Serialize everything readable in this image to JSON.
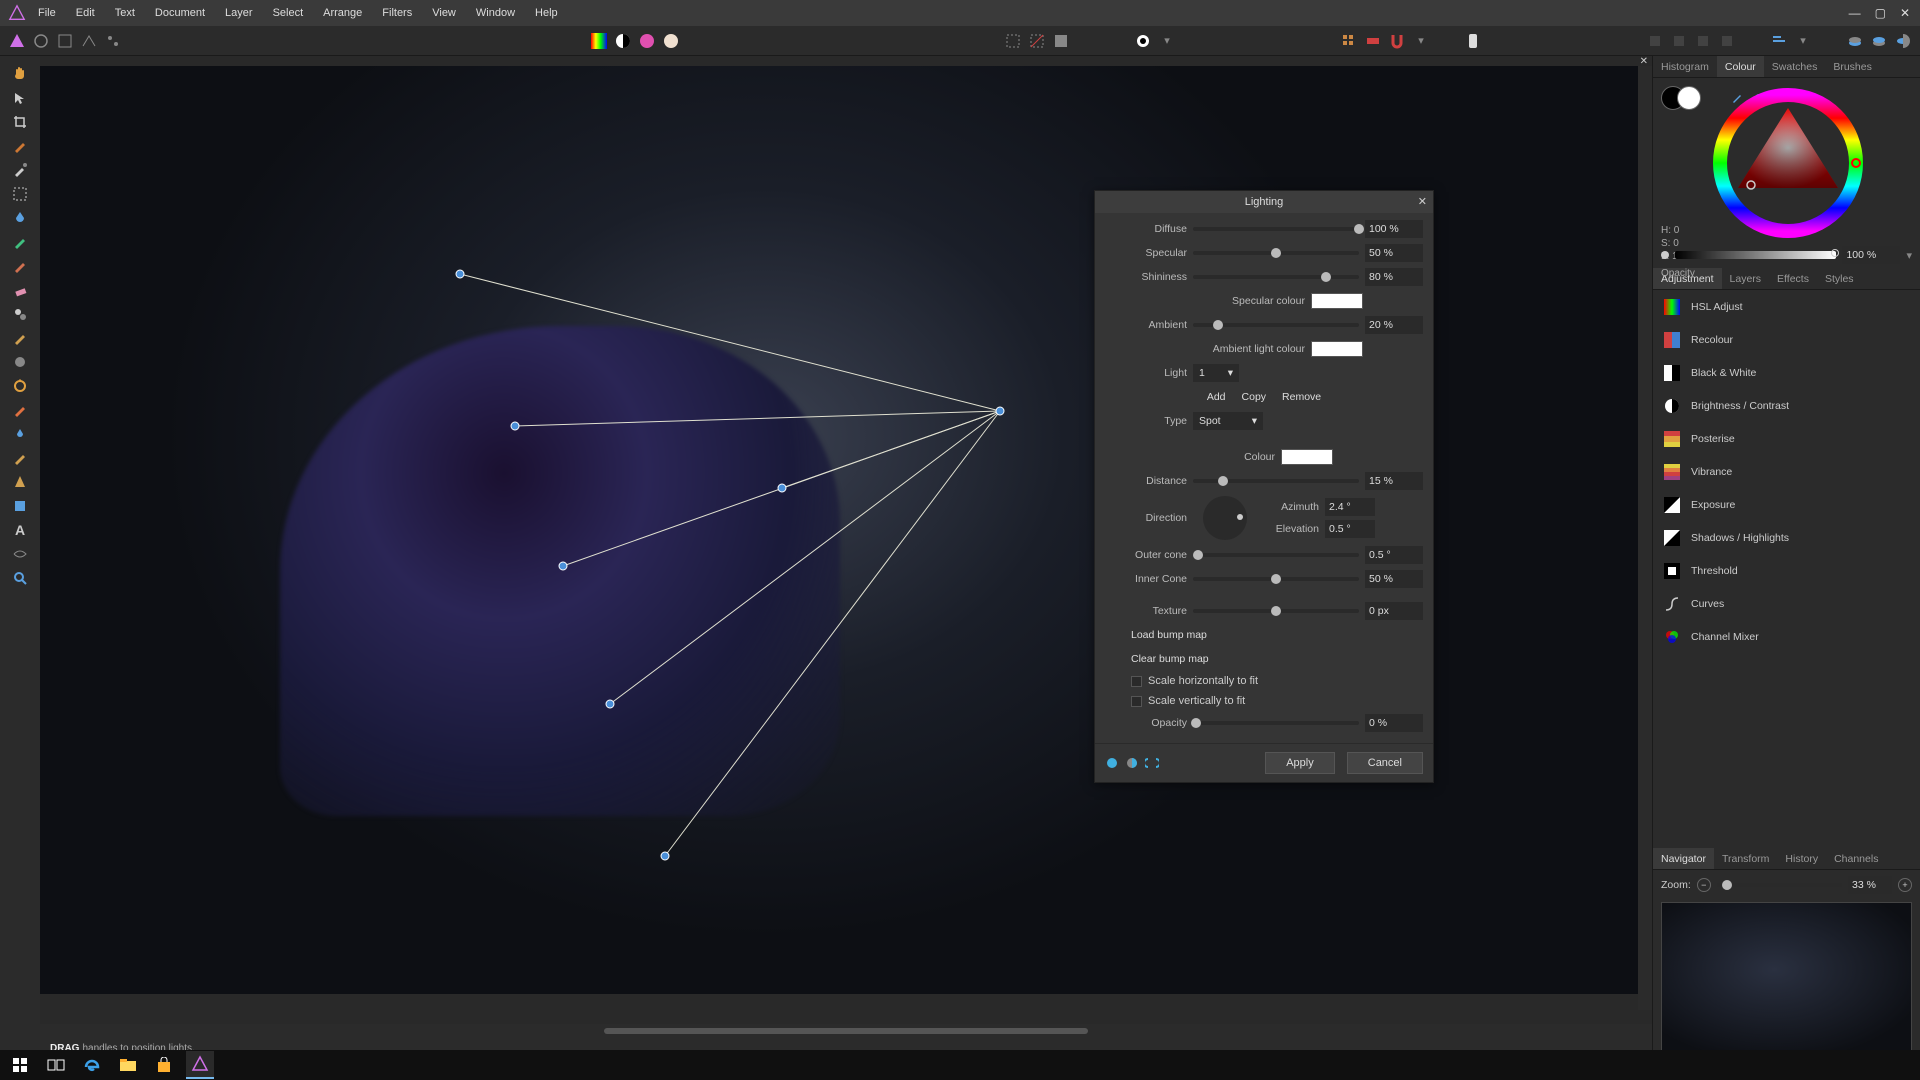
{
  "menubar": {
    "items": [
      "File",
      "Edit",
      "Text",
      "Document",
      "Layer",
      "Select",
      "Arrange",
      "Filters",
      "View",
      "Window",
      "Help"
    ]
  },
  "dialog": {
    "title": "Lighting",
    "diffuse": {
      "label": "Diffuse",
      "value": "100 %",
      "pct": 100
    },
    "specular": {
      "label": "Specular",
      "value": "50 %",
      "pct": 50
    },
    "shininess": {
      "label": "Shininess",
      "value": "80 %",
      "pct": 80
    },
    "specular_colour_label": "Specular colour",
    "ambient": {
      "label": "Ambient",
      "value": "20 %",
      "pct": 15
    },
    "ambient_colour_label": "Ambient light colour",
    "light_label": "Light",
    "light_value": "1",
    "actions": {
      "add": "Add",
      "copy": "Copy",
      "remove": "Remove"
    },
    "type_label": "Type",
    "type_value": "Spot",
    "colour_label": "Colour",
    "distance": {
      "label": "Distance",
      "value": "15 %",
      "pct": 18
    },
    "direction_label": "Direction",
    "azimuth": {
      "label": "Azimuth",
      "value": "2.4 °"
    },
    "elevation": {
      "label": "Elevation",
      "value": "0.5 °"
    },
    "outer_cone": {
      "label": "Outer cone",
      "value": "0.5 °",
      "pct": 3
    },
    "inner_cone": {
      "label": "Inner Cone",
      "value": "50 %",
      "pct": 50
    },
    "texture": {
      "label": "Texture",
      "value": "0 px",
      "pct": 50
    },
    "load_bump": "Load bump map",
    "clear_bump": "Clear bump map",
    "scale_h": "Scale horizontally to fit",
    "scale_v": "Scale vertically to fit",
    "opacity": {
      "label": "Opacity",
      "value": "0 %",
      "pct": 2
    },
    "apply": "Apply",
    "cancel": "Cancel"
  },
  "right": {
    "tabs1": [
      "Histogram",
      "Colour",
      "Swatches",
      "Brushes"
    ],
    "hsl": {
      "h": "H: 0",
      "s": "S: 0",
      "l": "L: 100"
    },
    "opacity_label": "Opacity",
    "opacity_value": "100 %",
    "tabs2": [
      "Adjustment",
      "Layers",
      "Effects",
      "Styles"
    ],
    "adjustments": [
      "HSL Adjust",
      "Recolour",
      "Black & White",
      "Brightness / Contrast",
      "Posterise",
      "Vibrance",
      "Exposure",
      "Shadows / Highlights",
      "Threshold",
      "Curves",
      "Channel Mixer"
    ],
    "tabs3": [
      "Navigator",
      "Transform",
      "History",
      "Channels"
    ],
    "zoom_label": "Zoom:",
    "zoom_value": "33 %"
  },
  "status": {
    "bold": "DRAG",
    "rest": "handles to position lights."
  }
}
